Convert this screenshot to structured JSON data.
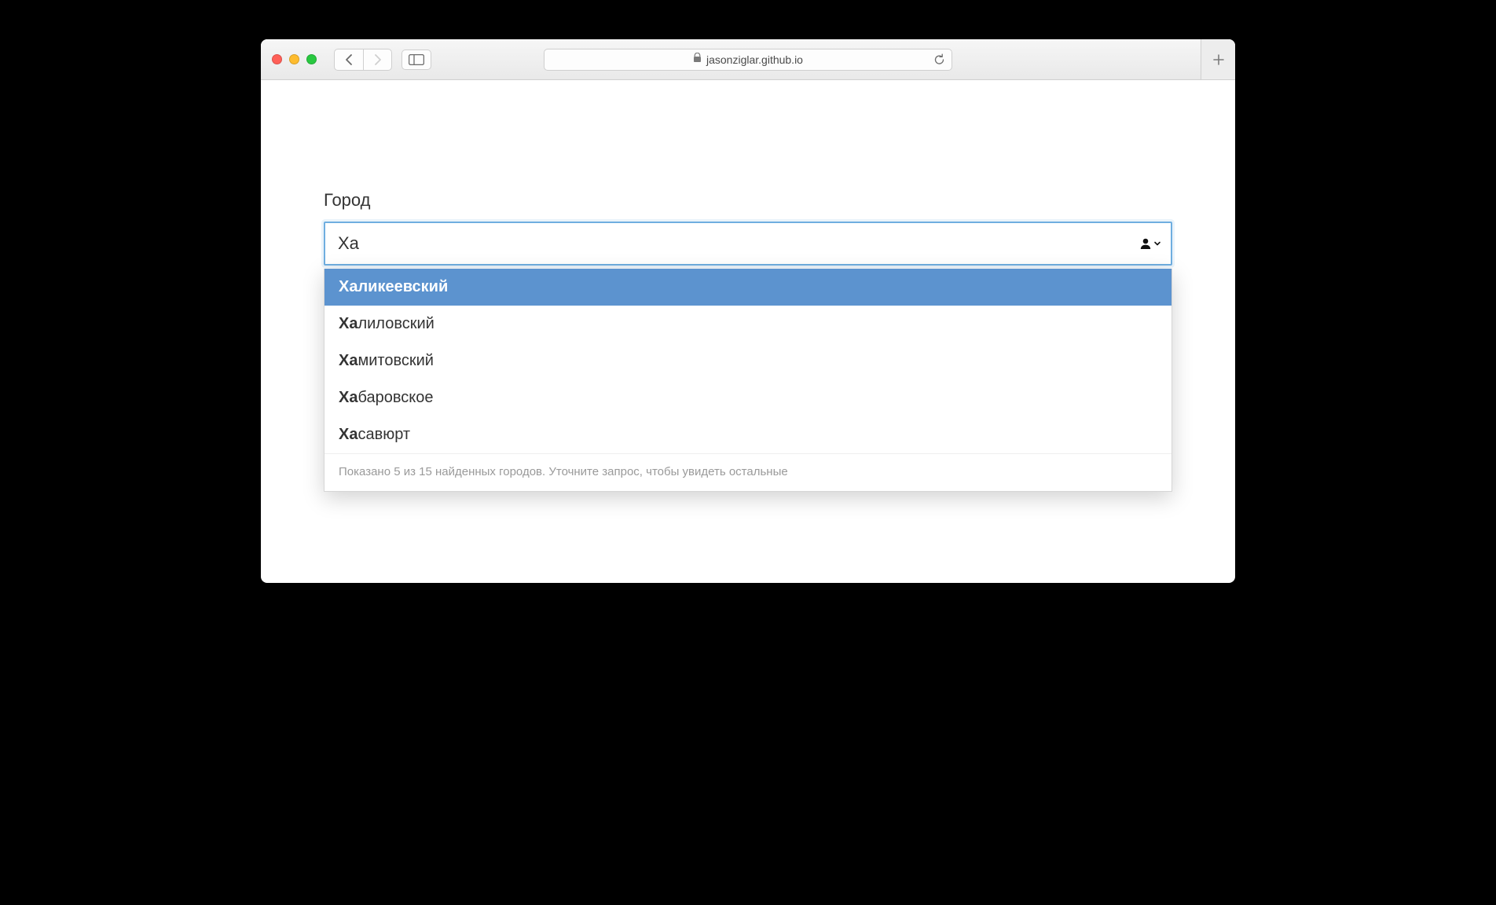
{
  "browser": {
    "url": "jasonziglar.github.io"
  },
  "form": {
    "city_label": "Город",
    "city_value": "Ха"
  },
  "suggestions": {
    "query": "Ха",
    "items": [
      {
        "match": "Ха",
        "rest": "ликеевский",
        "selected": true
      },
      {
        "match": "Ха",
        "rest": "лиловский",
        "selected": false
      },
      {
        "match": "Ха",
        "rest": "митовский",
        "selected": false
      },
      {
        "match": "Ха",
        "rest": "баровское",
        "selected": false
      },
      {
        "match": "Ха",
        "rest": "савюрт",
        "selected": false
      }
    ],
    "footer": "Показано 5 из 15 найденных городов. Уточните запрос, чтобы увидеть остальные"
  }
}
